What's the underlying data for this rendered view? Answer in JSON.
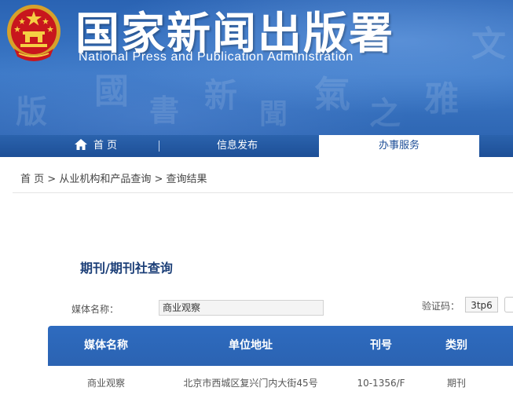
{
  "header": {
    "title_cn": "国家新闻出版署",
    "title_en": "National  Press and Publication Administration"
  },
  "nav": {
    "items": [
      {
        "label": "首 页",
        "icon": "home-icon"
      },
      {
        "label": "信息发布"
      },
      {
        "label": "办事服务",
        "active": true
      }
    ]
  },
  "breadcrumb": [
    "首 页",
    "从业机构和产品查询",
    "查询结果"
  ],
  "breadcrumb_sep": ">",
  "search": {
    "section_title": "期刊/期刊社查询",
    "media_label": "媒体名称：",
    "media_value": "商业观察",
    "captcha_label": "验证码：",
    "captcha_text": "3tp6"
  },
  "table": {
    "headers": [
      "媒体名称",
      "单位地址",
      "刊号",
      "类别"
    ],
    "rows": [
      [
        "商业观察",
        "北京市西城区复兴门内大街45号",
        "10-1356/F",
        "期刊"
      ]
    ]
  },
  "colors": {
    "banner_blue": "#2f6bb8",
    "nav_blue": "#1d4f97",
    "table_header": "#2e6bbf",
    "title_text": "#1c3f78"
  }
}
